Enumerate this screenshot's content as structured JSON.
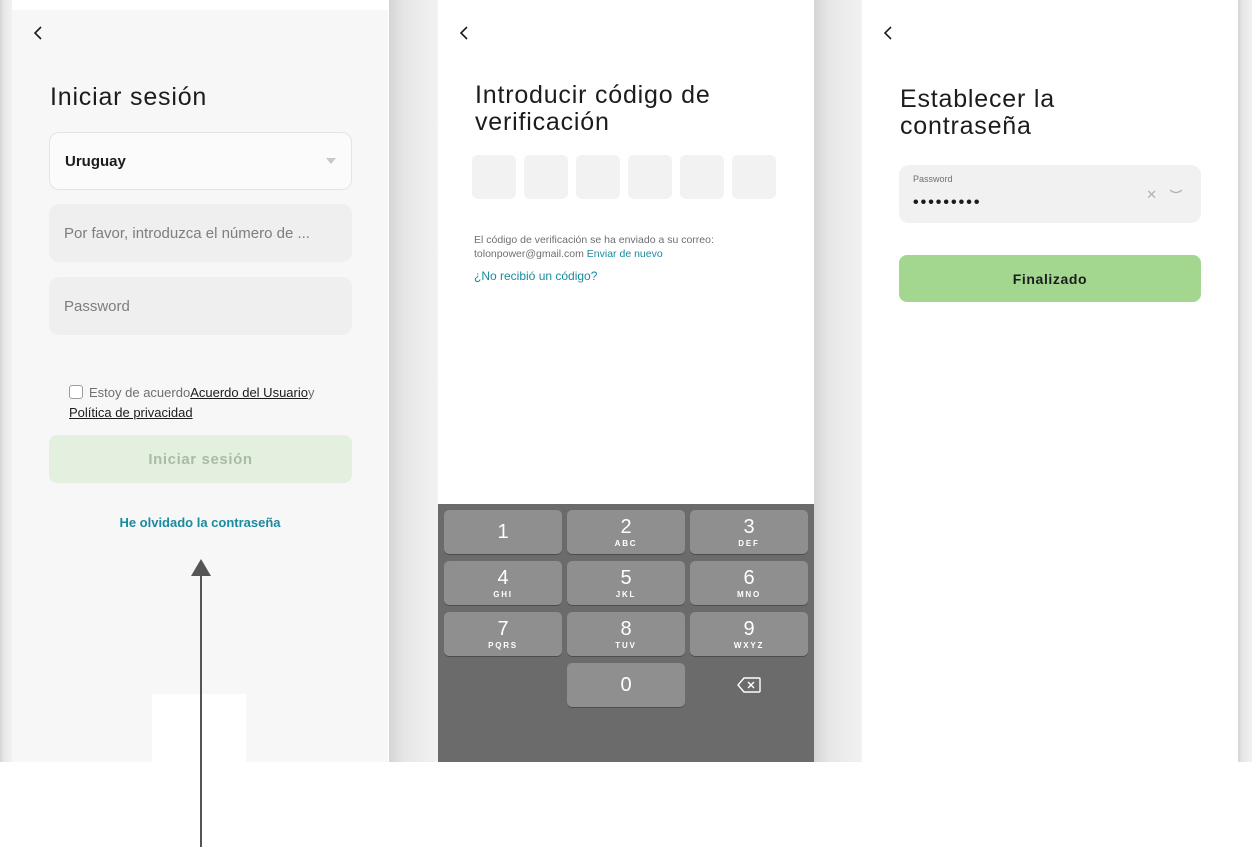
{
  "screen_login": {
    "title": "Iniciar sesión",
    "country": "Uruguay",
    "phone_placeholder": "Por favor, introduzca el número de ...",
    "password_placeholder": "Password",
    "agree_prefix": "Estoy de acuerdo",
    "user_agreement": "Acuerdo del Usuario",
    "agree_and": "y",
    "privacy_policy": "Política de privacidad",
    "login_button": "Iniciar sesión",
    "forgot_password": "He olvidado la contraseña"
  },
  "screen_verify": {
    "title_line1": "Introducir código de",
    "title_line2": "verificación",
    "code_length": 6,
    "sent_text": "El código de verificación se ha enviado a su correo:",
    "email": "tolonpower@gmail.com",
    "resend": "Enviar de nuevo",
    "no_code": "¿No recibió un código?",
    "keypad": [
      {
        "num": "1",
        "letters": ""
      },
      {
        "num": "2",
        "letters": "ABC"
      },
      {
        "num": "3",
        "letters": "DEF"
      },
      {
        "num": "4",
        "letters": "GHI"
      },
      {
        "num": "5",
        "letters": "JKL"
      },
      {
        "num": "6",
        "letters": "MNO"
      },
      {
        "num": "7",
        "letters": "PQRS"
      },
      {
        "num": "8",
        "letters": "TUV"
      },
      {
        "num": "9",
        "letters": "WXYZ"
      },
      {
        "num": "0",
        "letters": ""
      }
    ]
  },
  "screen_password": {
    "title_line1": "Establecer la",
    "title_line2": "contraseña",
    "password_label": "Password",
    "password_value": "•••••••••",
    "finish_button": "Finalizado"
  },
  "colors": {
    "accent_teal": "#1a8a9e",
    "green_button": "#a3d68f",
    "green_disabled": "#e4f0df",
    "keypad_bg": "#6b6b6b"
  },
  "icons": [
    "chevron-left-icon",
    "dropdown-caret-icon",
    "checkbox-icon",
    "backspace-icon",
    "clear-icon",
    "eye-closed-icon",
    "arrow-up-icon"
  ]
}
